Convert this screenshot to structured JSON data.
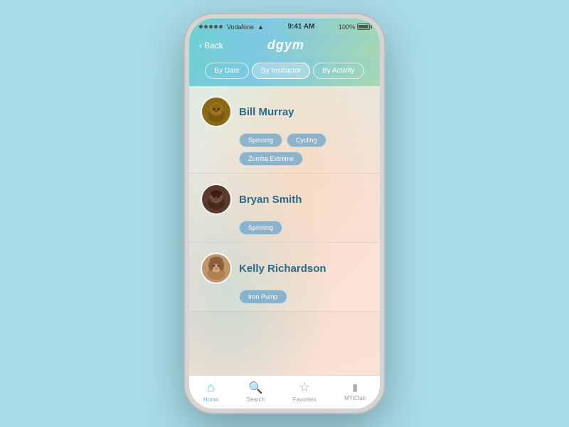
{
  "status_bar": {
    "dots": 5,
    "carrier": "Vodafone",
    "time": "9:41 AM",
    "battery": "100%"
  },
  "header": {
    "back_label": "Back",
    "app_name": "dgym"
  },
  "filter_tabs": [
    {
      "id": "by-date",
      "label": "By Date",
      "active": false
    },
    {
      "id": "by-instructor",
      "label": "By Instructor",
      "active": true
    },
    {
      "id": "by-activity",
      "label": "By Activity",
      "active": false
    }
  ],
  "instructors": [
    {
      "id": "bill-murray",
      "name": "Bill Murray",
      "avatar_type": "bill",
      "tags": [
        "Spinning",
        "Cycling",
        "Zumba Extreme"
      ]
    },
    {
      "id": "bryan-smith",
      "name": "Bryan Smith",
      "avatar_type": "bryan",
      "tags": [
        "Spinning"
      ]
    },
    {
      "id": "kelly-richardson",
      "name": "Kelly Richardson",
      "avatar_type": "kelly",
      "tags": [
        "Iron Pump"
      ]
    }
  ],
  "bottom_nav": [
    {
      "id": "home",
      "icon": "⌂",
      "label": "Home",
      "active": true
    },
    {
      "id": "search",
      "icon": "⌕",
      "label": "Search",
      "active": false
    },
    {
      "id": "favorites",
      "icon": "☆",
      "label": "Favorites",
      "active": false
    },
    {
      "id": "myiclub",
      "icon": "▬",
      "label": "MYiClub",
      "active": false
    }
  ],
  "colors": {
    "accent": "#5bb8d4",
    "tag_bg": "rgba(100,160,200,0.7)",
    "name_color": "#2a6a8a"
  }
}
